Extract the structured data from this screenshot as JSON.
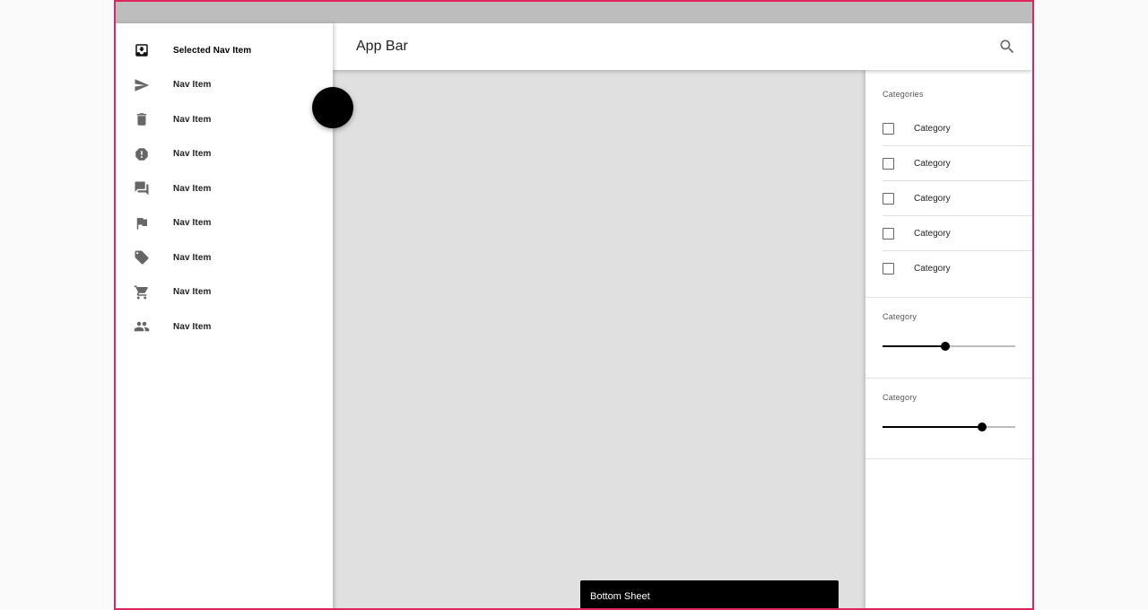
{
  "nav": {
    "items": [
      {
        "label": "Selected Nav Item",
        "icon": "inbox-icon",
        "selected": true
      },
      {
        "label": "Nav Item",
        "icon": "send-icon",
        "selected": false
      },
      {
        "label": "Nav Item",
        "icon": "trash-icon",
        "selected": false
      },
      {
        "label": "Nav Item",
        "icon": "alert-icon",
        "selected": false
      },
      {
        "label": "Nav Item",
        "icon": "forum-icon",
        "selected": false
      },
      {
        "label": "Nav Item",
        "icon": "flag-icon",
        "selected": false
      },
      {
        "label": "Nav Item",
        "icon": "label-icon",
        "selected": false
      },
      {
        "label": "Nav Item",
        "icon": "cart-icon",
        "selected": false
      },
      {
        "label": "Nav Item",
        "icon": "people-icon",
        "selected": false
      }
    ]
  },
  "app_bar": {
    "title": "App Bar",
    "search_icon": "search-icon"
  },
  "filters": {
    "categories_label": "Categories",
    "categories": [
      {
        "label": "Category",
        "checked": false
      },
      {
        "label": "Category",
        "checked": false
      },
      {
        "label": "Category",
        "checked": false
      },
      {
        "label": "Category",
        "checked": false
      },
      {
        "label": "Category",
        "checked": false
      }
    ],
    "sliders": [
      {
        "label": "Category",
        "value": 0.47
      },
      {
        "label": "Category",
        "value": 0.75
      }
    ]
  },
  "bottom_sheet": {
    "label": "Bottom Sheet"
  },
  "colors": {
    "frame_border": "#e0245e",
    "accent": "#000000",
    "content_bg": "#e0e0e0",
    "status_bar": "#bdbdbd"
  }
}
